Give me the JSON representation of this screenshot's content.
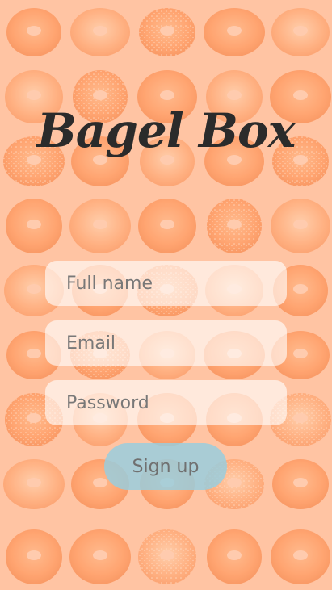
{
  "app": {
    "title": "Bagel Box"
  },
  "form": {
    "full_name_placeholder": "Full name",
    "email_placeholder": "Email",
    "password_placeholder": "Password",
    "full_name_value": "",
    "email_value": "",
    "password_value": "",
    "submit_label": "Sign up"
  },
  "theme": {
    "background": "#ffc4a3",
    "bagel_color": "#ff9a63",
    "bagel_color_alt": "#ffb07a",
    "button_color": "#96cee0",
    "title_color": "#2b2b2b"
  },
  "background": {
    "pattern": "bagel-icon"
  }
}
